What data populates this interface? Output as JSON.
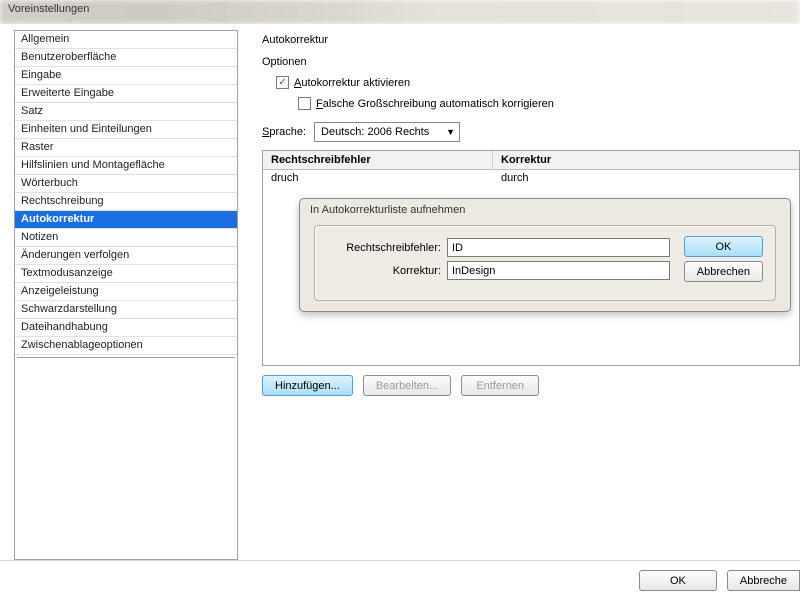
{
  "window": {
    "title": "Voreinstellungen"
  },
  "sidebar": {
    "items": [
      "Allgemein",
      "Benutzeroberfläche",
      "Eingabe",
      "Erweiterte Eingabe",
      "Satz",
      "Einheiten und Einteilungen",
      "Raster",
      "Hilfslinien und Montagefläche",
      "Wörterbuch",
      "Rechtschreibung",
      "Autokorrektur",
      "Notizen",
      "Änderungen verfolgen",
      "Textmodusanzeige",
      "Anzeigeleistung",
      "Schwarzdarstellung",
      "Dateihandhabung",
      "Zwischenablageoptionen"
    ],
    "selected_index": 10
  },
  "panel": {
    "title": "Autokorrektur",
    "options_label": "Optionen",
    "opt1": {
      "u": "A",
      "rest": "utokorrektur aktivieren",
      "checked": true
    },
    "opt2": {
      "u": "F",
      "rest": "alsche Großschreibung automatisch korrigieren",
      "checked": false
    },
    "lang": {
      "u": "S",
      "rest": "prache:",
      "value": "Deutsch: 2006 Rechts"
    },
    "buttons": {
      "add": "Hinzufügen...",
      "edit": "Bearbeiten...",
      "remove": "Entfernen"
    }
  },
  "table": {
    "headers": [
      "Rechtschreibfehler",
      "Korrektur"
    ],
    "rows": [
      [
        "druch",
        "durch"
      ]
    ]
  },
  "dialog": {
    "title": "In Autokorrekturliste aufnehmen",
    "field1_label": "Rechtschreibfehler:",
    "field1_value": "ID",
    "field2_label": "Korrektur:",
    "field2_value": "InDesign",
    "ok": "OK",
    "cancel": "Abbrechen"
  },
  "footer": {
    "ok": "OK",
    "cancel": "Abbreche"
  }
}
